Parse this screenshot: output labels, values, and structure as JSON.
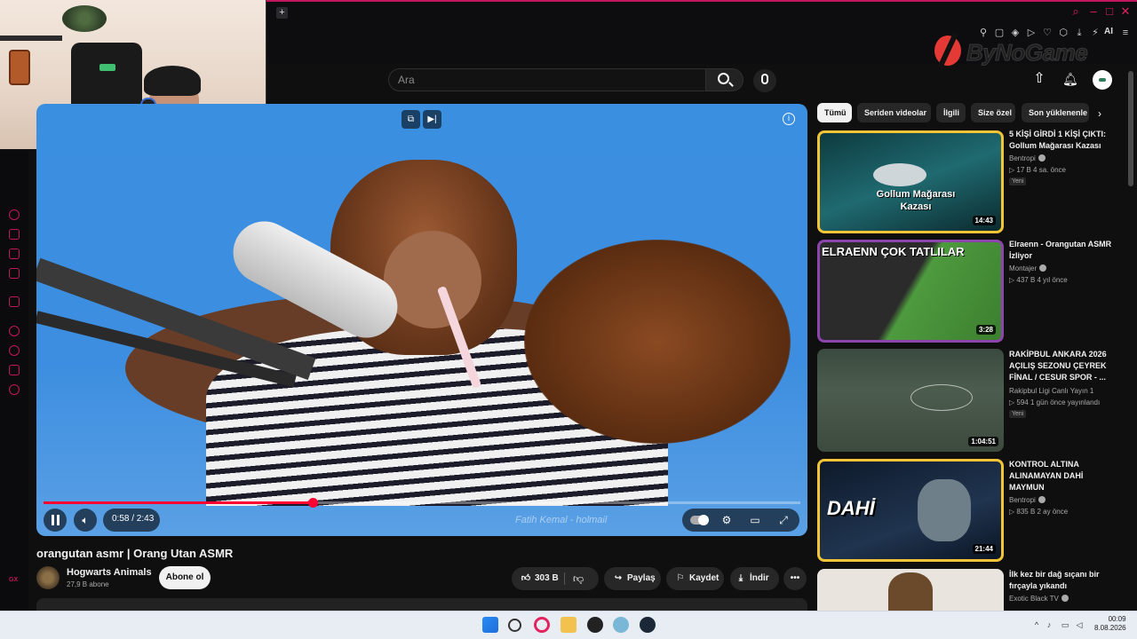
{
  "browser": {
    "new_tab_icon": "plus-icon",
    "ai_label": "AI",
    "window_controls": [
      "search-icon",
      "minimize-icon",
      "maximize-icon",
      "close-icon"
    ]
  },
  "watermark": {
    "text": "ByNoGame"
  },
  "youtube": {
    "search_placeholder": "Ara",
    "video": {
      "title": "orangutan asmr | Orang Utan ASMR",
      "time_display": "0:58 / 2:43",
      "progress_fraction": 0.356,
      "overlay_text": "Fatih Kemal - holmail"
    },
    "channel": {
      "name": "Hogwarts Animals",
      "subscribers": "27,9 B abone",
      "subscribe_label": "Abone ol"
    },
    "actions": {
      "like_count": "303 B",
      "share_label": "Paylaş",
      "save_label": "Kaydet",
      "download_label": "İndir",
      "more_label": "•••"
    },
    "chips": [
      "Tümü",
      "Seriden videolar",
      "İlgili",
      "Size özel",
      "Son yüklenenle"
    ],
    "recommendations": [
      {
        "title": "5 KİŞİ GİRDİ 1 KİŞİ ÇIKTI: Gollum Mağarası Kazası",
        "channel": "Bentropi",
        "meta": "▷ 17 B   4 sa. önce",
        "badge": "Yeni",
        "duration": "14:43",
        "thumb_text": "Gollum Mağarası Kazası"
      },
      {
        "title": "Elraenn - Orangutan ASMR İzliyor",
        "channel": "Montajer",
        "meta": "▷ 437 B   4 yıl önce",
        "badge": "",
        "duration": "3:28",
        "thumb_text": "ELRAENN   ÇOK TATLILAR"
      },
      {
        "title": "RAKİPBUL ANKARA 2026 AÇILIŞ SEZONU ÇEYREK FİNAL / CESUR SPOR - ...",
        "channel": "Rakipbul Ligi Canlı Yayın 1",
        "meta": "▷ 594   1 gün önce yayınlandı",
        "badge": "Yeni",
        "duration": "1:04:51",
        "thumb_text": ""
      },
      {
        "title": "KONTROL ALTINA ALINAMAYAN DAHİ MAYMUN",
        "channel": "Bentropi",
        "meta": "▷ 835 B   2 ay önce",
        "badge": "",
        "duration": "21:44",
        "thumb_text": "DAHİ"
      },
      {
        "title": "İlk kez bir dağ sıçanı bir fırçayla yıkandı",
        "channel": "Exotic Black TV",
        "meta": "",
        "badge": "",
        "duration": "",
        "thumb_text": ""
      }
    ]
  },
  "taskbar": {
    "time": "00:09",
    "date": "8.08.2026"
  }
}
